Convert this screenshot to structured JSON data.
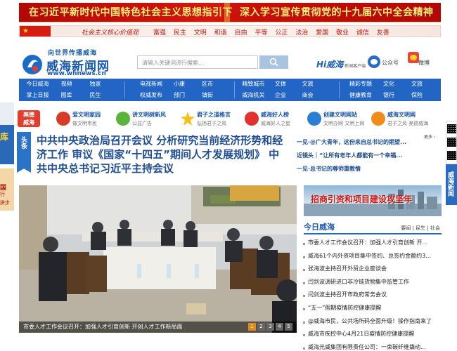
{
  "banner": {
    "left": "在习近平新时代中国特色社会主义思想指引下",
    "right": "深入学习宣传贯彻党的十九届六中全会精神"
  },
  "values_strip": {
    "title": "社会主义核心价值观",
    "items": [
      "富强",
      "民主",
      "文明",
      "和谐",
      "自由",
      "平等",
      "公正",
      "法治",
      "爱国",
      "敬业",
      "诚信",
      "友善"
    ]
  },
  "header": {
    "slogan": "向世界传播威海",
    "logo_text": "威海新闻网",
    "logo_url": "www.whnews.cn",
    "search_placeholder": "请输入关键词进行搜索...",
    "hi_weihai": "Hi威海",
    "hi_weihai_sub": "新闻客户端",
    "wechat_label": "公众号",
    "weibo_label": "微博",
    "accent": "#2265c4"
  },
  "nav": {
    "groups": [
      [
        "今日威海",
        "视频",
        "独家",
        "掌上日报",
        "图库",
        "民生"
      ],
      [
        "电视新闻",
        "小康",
        "区市",
        "权威发布",
        "部门",
        "镇街"
      ],
      [
        "精致城市",
        "文体",
        "文旅",
        "威海机关",
        "企业",
        "商会"
      ],
      [
        "精彩专题",
        "文化",
        "文旅",
        "健康教育",
        "银行",
        "保险"
      ]
    ]
  },
  "guide": {
    "logo_line1": "美德",
    "logo_line2": "威海",
    "items": [
      {
        "title": "爱文明家园",
        "sub": "做文明市民",
        "icon": "heart-hands-icon"
      },
      {
        "title": "讲文明树新风",
        "sub": "公益广告",
        "icon": "leaf-icon"
      },
      {
        "title": "君子之道格言",
        "sub": "弘扬君子之风",
        "icon": "star-icon"
      },
      {
        "title": "威海好人榜",
        "sub": "威海好人之星",
        "icon": "heart-icon"
      },
      {
        "title": "创建文明网站",
        "sub": "文明办网 文明上网",
        "icon": "globe-icon"
      },
      {
        "title": "威海文明网",
        "sub": "君子之风 美德威海",
        "icon": "cloud-icon"
      }
    ]
  },
  "left_ads": {
    "ad1": "库",
    "ad2_line1": "国",
    "ad2_line2": "行",
    "ad2_line3": "拼步"
  },
  "headline": {
    "tag": "头条",
    "text": "中共中央政治局召开会议 分析研究当前经济形势和经济工作 审议《国家“十四五”期间人才发展规划》 中共中央总书记习近平主持会议"
  },
  "right_news": {
    "more": "更多",
    "items": [
      "一见·@广大青年，这份来自总书记的期望...",
      "近镜头｜“让所有老年人都能有一个幸福...",
      "一见·总书记的尊师重教情"
    ]
  },
  "qr": {
    "side_text": "威海新闻"
  },
  "photo": {
    "caption": "市委人才工作会议召开：加强人才引育创新 开创人才工作新局面",
    "pages": [
      "1",
      "2",
      "3",
      "4",
      "5"
    ],
    "active_page": 1
  },
  "invest_banner": {
    "title": "招商引资和项目建设攻坚年"
  },
  "today": {
    "title": "今日威海",
    "tabs": "要闻 | 民生 | 社会",
    "items": [
      "市委人才工作会议召开：加强人才引育创新 开...",
      "威海61个内外资项目集中签约、总签约金额约3...",
      "张海波主持召开外贸企业座谈会",
      "闫剑波调研进口非冷链货物集中监管工作",
      "闫剑波主持召开市政府常务会议",
      "“五一”假期疫情防控健康提醒",
      "@威海市民，公共场所码全面升级！操作指南来了",
      "威海市疾控中心4月21日疫情防控健康提醒",
      "威海光威集团有限责任公司：一束碳纤维撬动..."
    ]
  }
}
